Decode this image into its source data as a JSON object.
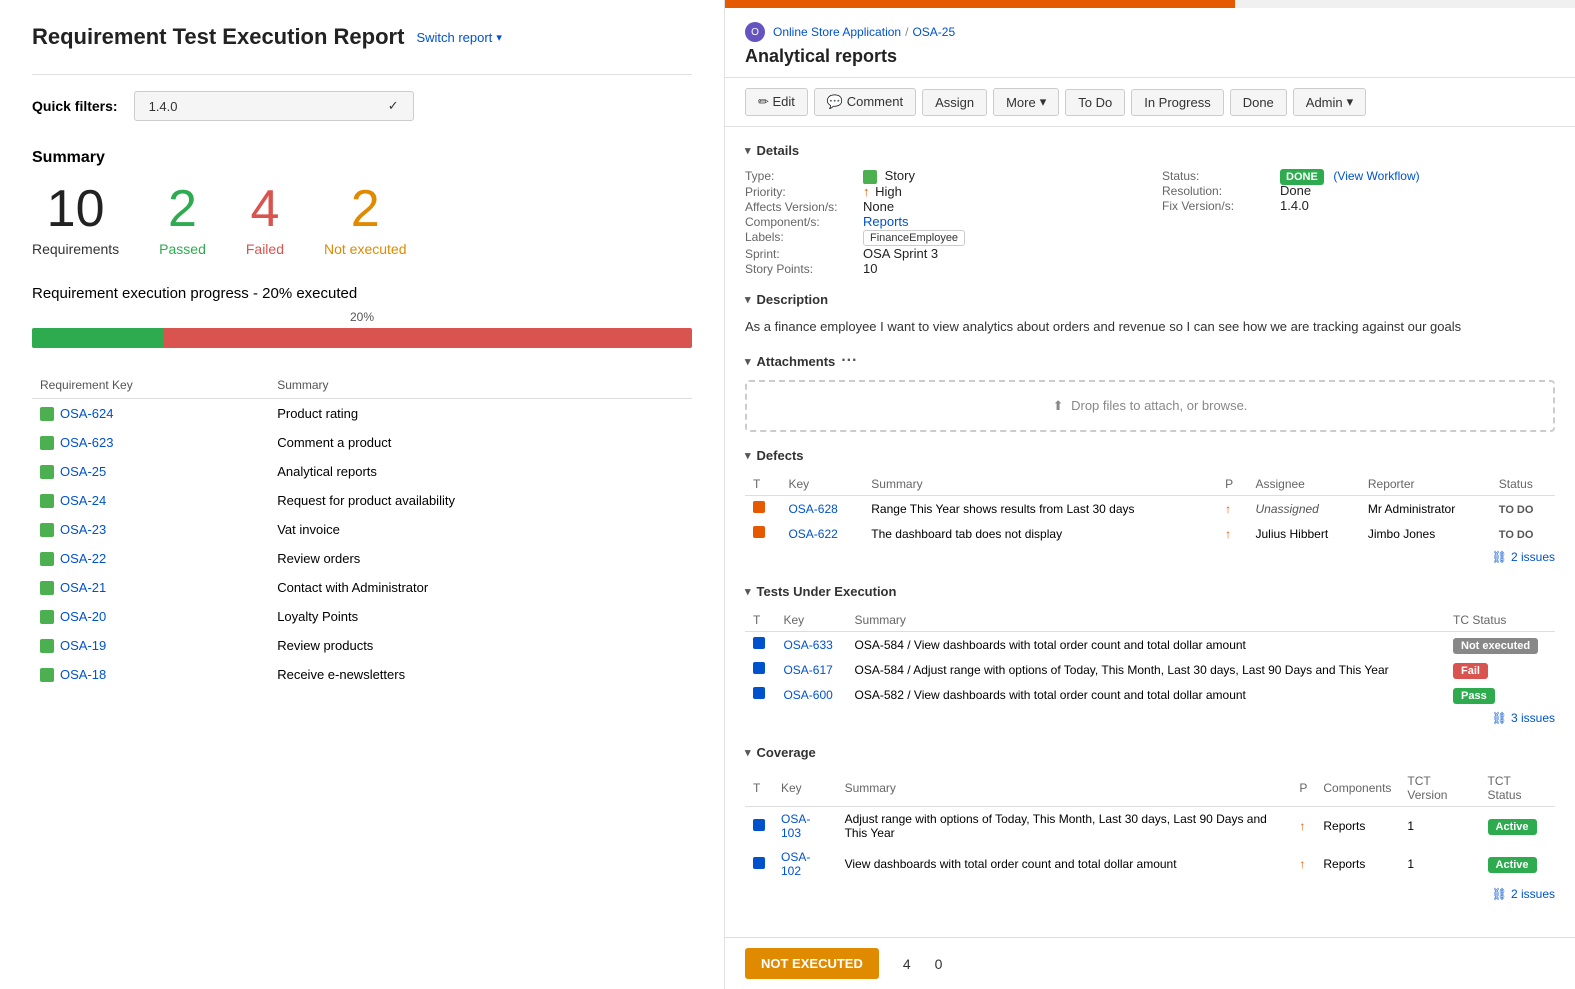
{
  "left": {
    "title": "Requirement Test Execution Report",
    "switch_report": "Switch report",
    "quick_filters_label": "Quick filters:",
    "filter_value": "1.4.0",
    "summary_title": "Summary",
    "summary": {
      "requirements": {
        "number": "10",
        "label": "Requirements"
      },
      "passed": {
        "number": "2",
        "label": "Passed"
      },
      "failed": {
        "number": "4",
        "label": "Failed"
      },
      "not_executed": {
        "number": "2",
        "label": "Not executed"
      }
    },
    "progress_title": "Requirement execution progress",
    "progress_suffix": "- 20% executed",
    "progress_pct": "20%",
    "progress_green_pct": 20,
    "progress_red_pct": 80,
    "table_headers": [
      "Requirement Key",
      "Summary"
    ],
    "requirements": [
      {
        "key": "OSA-624",
        "summary": "Product rating"
      },
      {
        "key": "OSA-623",
        "summary": "Comment a product"
      },
      {
        "key": "OSA-25",
        "summary": "Analytical reports"
      },
      {
        "key": "OSA-24",
        "summary": "Request for product availability"
      },
      {
        "key": "OSA-23",
        "summary": "Vat invoice"
      },
      {
        "key": "OSA-22",
        "summary": "Review orders"
      },
      {
        "key": "OSA-21",
        "summary": "Contact with Administrator"
      },
      {
        "key": "OSA-20",
        "summary": "Loyalty Points"
      },
      {
        "key": "OSA-19",
        "summary": "Review products"
      },
      {
        "key": "OSA-18",
        "summary": "Receive e-newsletters"
      }
    ]
  },
  "right": {
    "app_icon_text": "O",
    "breadcrumb_app": "Online Store Application",
    "breadcrumb_sep": "/",
    "breadcrumb_issue": "OSA-25",
    "issue_title": "Analytical reports",
    "actions": {
      "edit": "✏ Edit",
      "comment": "💬 Comment",
      "assign": "Assign",
      "more": "More",
      "more_arrow": "▾",
      "todo": "To Do",
      "in_progress": "In Progress",
      "done": "Done",
      "admin": "Admin",
      "admin_arrow": "▾"
    },
    "details": {
      "section_label": "Details",
      "type_label": "Type:",
      "type_value": "Story",
      "priority_label": "Priority:",
      "priority_value": "High",
      "affects_label": "Affects Version/s:",
      "affects_value": "None",
      "component_label": "Component/s:",
      "component_value": "Reports",
      "labels_label": "Labels:",
      "labels_value": "FinanceEmployee",
      "sprint_label": "Sprint:",
      "sprint_value": "OSA Sprint 3",
      "story_points_label": "Story Points:",
      "story_points_value": "10",
      "status_label": "Status:",
      "status_value": "DONE",
      "view_workflow": "(View Workflow)",
      "resolution_label": "Resolution:",
      "resolution_value": "Done",
      "fix_version_label": "Fix Version/s:",
      "fix_version_value": "1.4.0"
    },
    "description": {
      "section_label": "Description",
      "text": "As a finance employee I want to view analytics about orders and revenue so I can see how we are tracking against our goals"
    },
    "attachments": {
      "section_label": "Attachments",
      "drop_text": "Drop files to attach, or browse."
    },
    "defects": {
      "section_label": "Defects",
      "headers": [
        "T",
        "Key",
        "Summary",
        "P",
        "Assignee",
        "Reporter",
        "Status"
      ],
      "rows": [
        {
          "key": "OSA-628",
          "summary": "Range This Year shows results from Last 30 days",
          "priority": "↑",
          "assignee": "Unassigned",
          "reporter": "Mr Administrator",
          "status": "TO DO"
        },
        {
          "key": "OSA-622",
          "summary": "The dashboard tab does not display",
          "priority": "↑",
          "assignee": "Julius Hibbert",
          "reporter": "Jimbo Jones",
          "status": "TO DO"
        }
      ],
      "issues_count": "2 issues"
    },
    "tests": {
      "section_label": "Tests Under Execution",
      "headers": [
        "T",
        "Key",
        "Summary",
        "TC Status"
      ],
      "rows": [
        {
          "key": "OSA-633",
          "summary": "OSA-584 / View dashboards with total order count and total dollar amount",
          "status": "Not executed"
        },
        {
          "key": "OSA-617",
          "summary": "OSA-584 / Adjust range with options of Today, This Month, Last 30 days, Last 90 Days and This Year",
          "status": "Fail"
        },
        {
          "key": "OSA-600",
          "summary": "OSA-582 / View dashboards with total order count and total dollar amount",
          "status": "Pass"
        }
      ],
      "issues_count": "3 issues"
    },
    "coverage": {
      "section_label": "Coverage",
      "headers": [
        "T",
        "Key",
        "Summary",
        "P",
        "Components",
        "TCT Version",
        "TCT Status"
      ],
      "rows": [
        {
          "key": "OSA-103",
          "summary": "Adjust range with options of Today, This Month, Last 30 days, Last 90 Days and This Year",
          "priority": "↑",
          "components": "Reports",
          "version": "1",
          "status": "Active"
        },
        {
          "key": "OSA-102",
          "summary": "View dashboards with total order count and total dollar amount",
          "priority": "↑",
          "components": "Reports",
          "version": "1",
          "status": "Active"
        }
      ],
      "issues_count": "2 issues"
    },
    "bottom_bar": {
      "not_executed_label": "NOT EXECUTED",
      "stat1": "4",
      "stat2": "0"
    }
  }
}
